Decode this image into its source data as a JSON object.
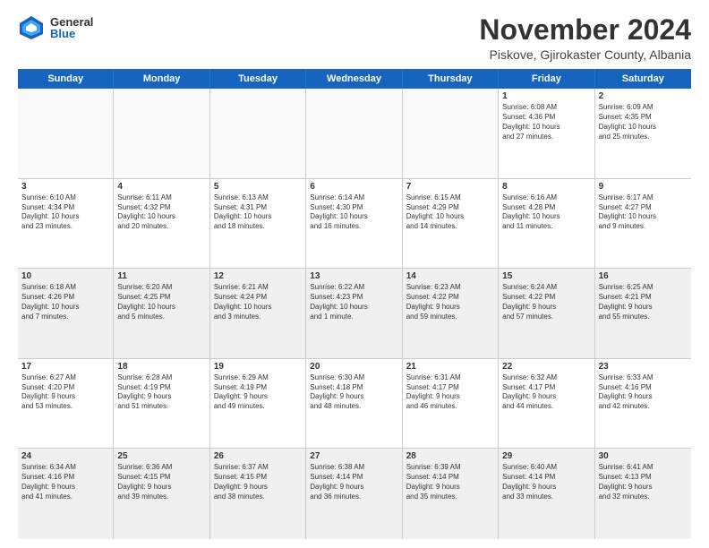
{
  "logo": {
    "general": "General",
    "blue": "Blue"
  },
  "title": "November 2024",
  "location": "Piskove, Gjirokaster County, Albania",
  "header": {
    "days": [
      "Sunday",
      "Monday",
      "Tuesday",
      "Wednesday",
      "Thursday",
      "Friday",
      "Saturday"
    ]
  },
  "weeks": [
    [
      {
        "day": "",
        "empty": true
      },
      {
        "day": "",
        "empty": true
      },
      {
        "day": "",
        "empty": true
      },
      {
        "day": "",
        "empty": true
      },
      {
        "day": "",
        "empty": true
      },
      {
        "day": "1",
        "info": "Sunrise: 6:08 AM\nSunset: 4:36 PM\nDaylight: 10 hours\nand 27 minutes."
      },
      {
        "day": "2",
        "info": "Sunrise: 6:09 AM\nSunset: 4:35 PM\nDaylight: 10 hours\nand 25 minutes."
      }
    ],
    [
      {
        "day": "3",
        "info": "Sunrise: 6:10 AM\nSunset: 4:34 PM\nDaylight: 10 hours\nand 23 minutes."
      },
      {
        "day": "4",
        "info": "Sunrise: 6:11 AM\nSunset: 4:32 PM\nDaylight: 10 hours\nand 20 minutes."
      },
      {
        "day": "5",
        "info": "Sunrise: 6:13 AM\nSunset: 4:31 PM\nDaylight: 10 hours\nand 18 minutes."
      },
      {
        "day": "6",
        "info": "Sunrise: 6:14 AM\nSunset: 4:30 PM\nDaylight: 10 hours\nand 16 minutes."
      },
      {
        "day": "7",
        "info": "Sunrise: 6:15 AM\nSunset: 4:29 PM\nDaylight: 10 hours\nand 14 minutes."
      },
      {
        "day": "8",
        "info": "Sunrise: 6:16 AM\nSunset: 4:28 PM\nDaylight: 10 hours\nand 11 minutes."
      },
      {
        "day": "9",
        "info": "Sunrise: 6:17 AM\nSunset: 4:27 PM\nDaylight: 10 hours\nand 9 minutes."
      }
    ],
    [
      {
        "day": "10",
        "info": "Sunrise: 6:18 AM\nSunset: 4:26 PM\nDaylight: 10 hours\nand 7 minutes."
      },
      {
        "day": "11",
        "info": "Sunrise: 6:20 AM\nSunset: 4:25 PM\nDaylight: 10 hours\nand 5 minutes."
      },
      {
        "day": "12",
        "info": "Sunrise: 6:21 AM\nSunset: 4:24 PM\nDaylight: 10 hours\nand 3 minutes."
      },
      {
        "day": "13",
        "info": "Sunrise: 6:22 AM\nSunset: 4:23 PM\nDaylight: 10 hours\nand 1 minute."
      },
      {
        "day": "14",
        "info": "Sunrise: 6:23 AM\nSunset: 4:22 PM\nDaylight: 9 hours\nand 59 minutes."
      },
      {
        "day": "15",
        "info": "Sunrise: 6:24 AM\nSunset: 4:22 PM\nDaylight: 9 hours\nand 57 minutes."
      },
      {
        "day": "16",
        "info": "Sunrise: 6:25 AM\nSunset: 4:21 PM\nDaylight: 9 hours\nand 55 minutes."
      }
    ],
    [
      {
        "day": "17",
        "info": "Sunrise: 6:27 AM\nSunset: 4:20 PM\nDaylight: 9 hours\nand 53 minutes."
      },
      {
        "day": "18",
        "info": "Sunrise: 6:28 AM\nSunset: 4:19 PM\nDaylight: 9 hours\nand 51 minutes."
      },
      {
        "day": "19",
        "info": "Sunrise: 6:29 AM\nSunset: 4:19 PM\nDaylight: 9 hours\nand 49 minutes."
      },
      {
        "day": "20",
        "info": "Sunrise: 6:30 AM\nSunset: 4:18 PM\nDaylight: 9 hours\nand 48 minutes."
      },
      {
        "day": "21",
        "info": "Sunrise: 6:31 AM\nSunset: 4:17 PM\nDaylight: 9 hours\nand 46 minutes."
      },
      {
        "day": "22",
        "info": "Sunrise: 6:32 AM\nSunset: 4:17 PM\nDaylight: 9 hours\nand 44 minutes."
      },
      {
        "day": "23",
        "info": "Sunrise: 6:33 AM\nSunset: 4:16 PM\nDaylight: 9 hours\nand 42 minutes."
      }
    ],
    [
      {
        "day": "24",
        "info": "Sunrise: 6:34 AM\nSunset: 4:16 PM\nDaylight: 9 hours\nand 41 minutes."
      },
      {
        "day": "25",
        "info": "Sunrise: 6:36 AM\nSunset: 4:15 PM\nDaylight: 9 hours\nand 39 minutes."
      },
      {
        "day": "26",
        "info": "Sunrise: 6:37 AM\nSunset: 4:15 PM\nDaylight: 9 hours\nand 38 minutes."
      },
      {
        "day": "27",
        "info": "Sunrise: 6:38 AM\nSunset: 4:14 PM\nDaylight: 9 hours\nand 36 minutes."
      },
      {
        "day": "28",
        "info": "Sunrise: 6:39 AM\nSunset: 4:14 PM\nDaylight: 9 hours\nand 35 minutes."
      },
      {
        "day": "29",
        "info": "Sunrise: 6:40 AM\nSunset: 4:14 PM\nDaylight: 9 hours\nand 33 minutes."
      },
      {
        "day": "30",
        "info": "Sunrise: 6:41 AM\nSunset: 4:13 PM\nDaylight: 9 hours\nand 32 minutes."
      }
    ]
  ]
}
